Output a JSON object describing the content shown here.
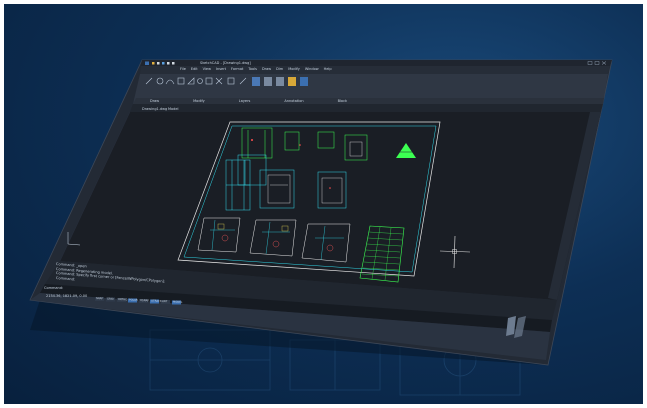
{
  "window": {
    "title": "SketchCAD - [Drawing1.dwg]",
    "file_tab": "Drawing1.dwg",
    "model_tab": "Model"
  },
  "menu": {
    "items": [
      "File",
      "Edit",
      "View",
      "Insert",
      "Format",
      "Tools",
      "Draw",
      "Dim",
      "Modify",
      "Window",
      "Help"
    ]
  },
  "ribbon": {
    "groups": [
      "Draw",
      "Modify",
      "Layers",
      "Annotation",
      "Block"
    ]
  },
  "command_line": {
    "lines": [
      "Command: _open",
      "Command: Regenerating model.",
      "Command: Specify first corner or [Fence/WPolygon/CPolygon]:",
      "Command:"
    ],
    "prompt": "Command:"
  },
  "status_bar": {
    "coords": "2154.36, 1821.09, 0.00",
    "toggles": [
      "SNAP",
      "GRID",
      "ORTHO",
      "POLAR",
      "OSNAP",
      "OTRACK",
      "LWT",
      "MODEL"
    ]
  },
  "colors": {
    "canvas": "#1b1f26",
    "chrome": "#2c3340",
    "ribbon": "#323a47",
    "accent": "#3b6fb0",
    "drawing_green": "#3cff52",
    "drawing_cyan": "#31d8e8",
    "drawing_white": "#e8e8e8"
  }
}
